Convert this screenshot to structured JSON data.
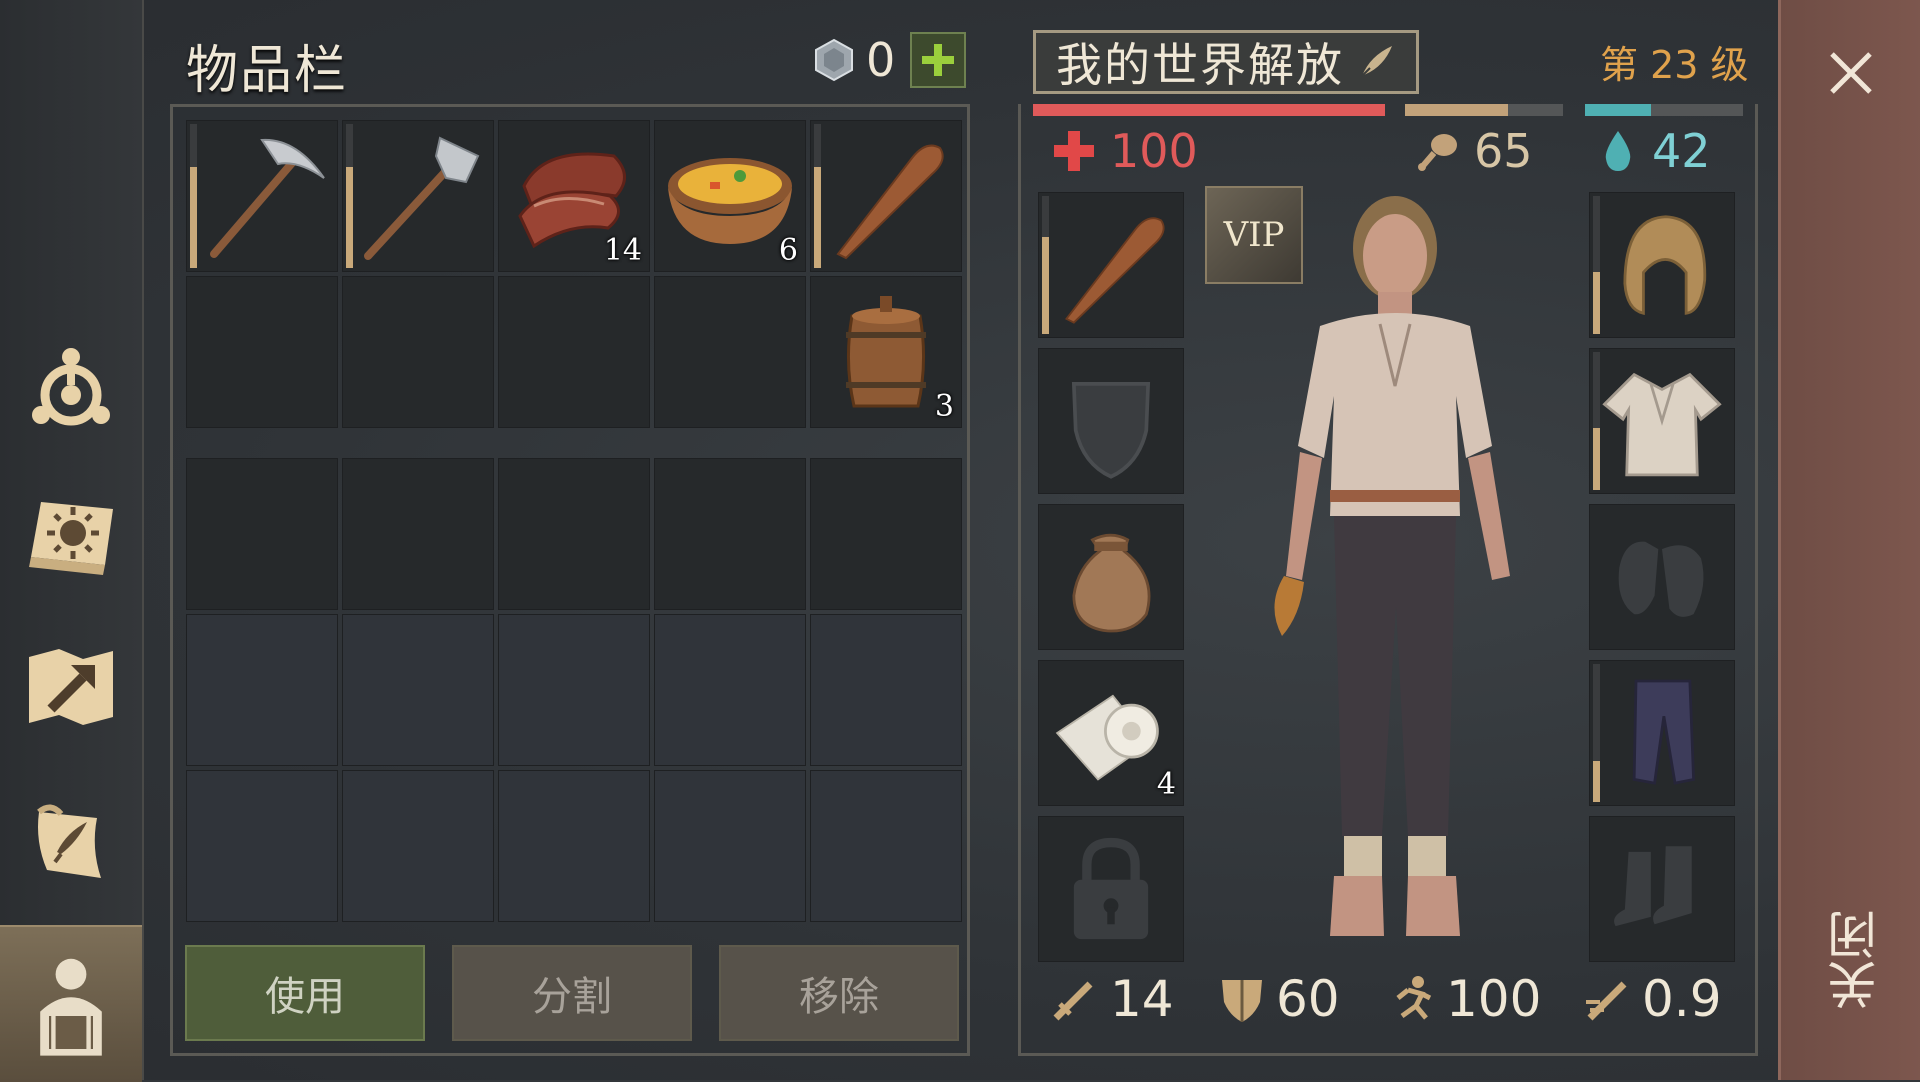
{
  "inventory": {
    "title": "物品栏",
    "currency_value": "0",
    "currency_icon": "gem-coin-icon",
    "add_icon": "plus-icon",
    "items": [
      {
        "icon": "pickaxe-icon",
        "qty": "",
        "durability": 0.7
      },
      {
        "icon": "hatchet-icon",
        "qty": "",
        "durability": 0.7
      },
      {
        "icon": "raw-meat-icon",
        "qty": "14"
      },
      {
        "icon": "soup-bowl-icon",
        "qty": "6"
      },
      {
        "icon": "wooden-club-icon",
        "qty": "",
        "durability": 0.7
      },
      {
        "icon": "",
        "qty": ""
      },
      {
        "icon": "",
        "qty": ""
      },
      {
        "icon": "",
        "qty": ""
      },
      {
        "icon": "",
        "qty": ""
      },
      {
        "icon": "barrel-icon",
        "qty": "3"
      }
    ],
    "buttons": {
      "use": "使用",
      "split": "分割",
      "remove": "移除"
    }
  },
  "character": {
    "name": "我的世界解放",
    "level": "第 23 级",
    "health": "100",
    "food": "65",
    "water": "42",
    "health_fill": 1.0,
    "food_fill": 0.65,
    "water_fill": 0.42,
    "vip_label": "VIP",
    "equipment_left": [
      {
        "icon": "wooden-club-icon",
        "qty": "",
        "durability": 0.7
      },
      {
        "icon": "shield-icon",
        "qty": ""
      },
      {
        "icon": "sack-icon",
        "qty": ""
      },
      {
        "icon": "bandage-roll-icon",
        "qty": "4"
      },
      {
        "icon": "lock-icon",
        "qty": ""
      }
    ],
    "equipment_right": [
      {
        "icon": "hood-icon",
        "durability": 0.45
      },
      {
        "icon": "shirt-icon",
        "durability": 0.45
      },
      {
        "icon": "gloves-icon"
      },
      {
        "icon": "pants-icon",
        "durability": 0.3
      },
      {
        "icon": "boots-icon"
      }
    ],
    "stats": {
      "attack": "14",
      "defense": "60",
      "speed": "100",
      "attack_speed": "0.9"
    },
    "colors": {
      "health": "#e05a5a",
      "food": "#c2a27a",
      "water": "#4fb0b3",
      "level": "#e0a24c"
    }
  },
  "close_label": "关闭"
}
